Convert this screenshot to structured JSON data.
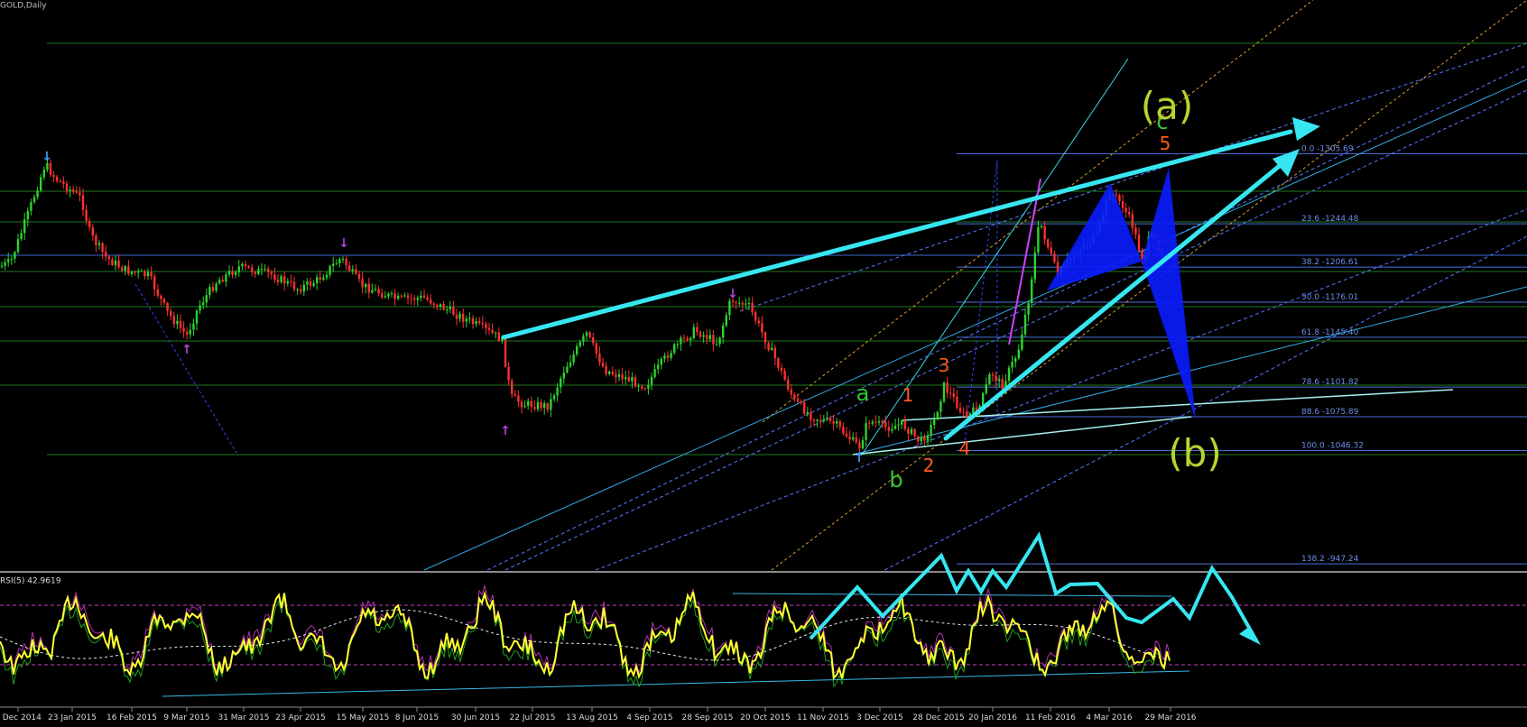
{
  "window_title": "GOLD,Daily",
  "chart_data": {
    "type": "candlestick",
    "symbol_label": "GOLD,Daily",
    "x_ticks": [
      "1 Dec 2014",
      "23 Jan 2015",
      "16 Feb 2015",
      "9 Mar 2015",
      "31 Mar 2015",
      "23 Apr 2015",
      "15 May 2015",
      "8 Jun 2015",
      "30 Jun 2015",
      "22 Jul 2015",
      "13 Aug 2015",
      "4 Sep 2015",
      "28 Sep 2015",
      "20 Oct 2015",
      "11 Nov 2015",
      "3 Dec 2015",
      "28 Dec 2015",
      "20 Jan 2016",
      "11 Feb 2016",
      "4 Mar 2016",
      "29 Mar 2016"
    ],
    "fib_levels": [
      {
        "label": "0.0 -1305.69",
        "ratio": "0.0",
        "price": 1305.69
      },
      {
        "label": "23.6 -1244.48",
        "ratio": "23.6",
        "price": 1244.48
      },
      {
        "label": "38.2 -1206.61",
        "ratio": "38.2",
        "price": 1206.61
      },
      {
        "label": "50.0 -1176.01",
        "ratio": "50.0",
        "price": 1176.01
      },
      {
        "label": "61.8 -1145.40",
        "ratio": "61.8",
        "price": 1145.4
      },
      {
        "label": "78.6 -1101.82",
        "ratio": "78.6",
        "price": 1101.82
      },
      {
        "label": "88.6 -1075.89",
        "ratio": "88.6",
        "price": 1075.89
      },
      {
        "label": "100.0 -1046.32",
        "ratio": "100.0",
        "price": 1046.32
      },
      {
        "label": "138.2 -947.24",
        "ratio": "138.2",
        "price": 947.24
      }
    ],
    "wave_labels": {
      "a": "a",
      "b": "b",
      "c": "c",
      "w1": "1",
      "w2": "2",
      "w3": "3",
      "w4": "4",
      "w5": "5",
      "big_a": "(a)",
      "big_b": "(b)"
    },
    "indicator": {
      "label": "RSI(5) 42.9619",
      "name": "RSI(5)",
      "value": 42.9619
    },
    "colors": {
      "bull": "#2bd42b",
      "bear": "#ff3030",
      "cyan": "#37e6f0",
      "fib": "#4b6fd6",
      "green_grid": "#1e7a1e",
      "rsi_line": "#ffff30",
      "harmonic": "#0a1cff",
      "wave_green": "#35c935",
      "wave_orange": "#ff5a1e",
      "wave_olive": "#b6d431"
    }
  }
}
